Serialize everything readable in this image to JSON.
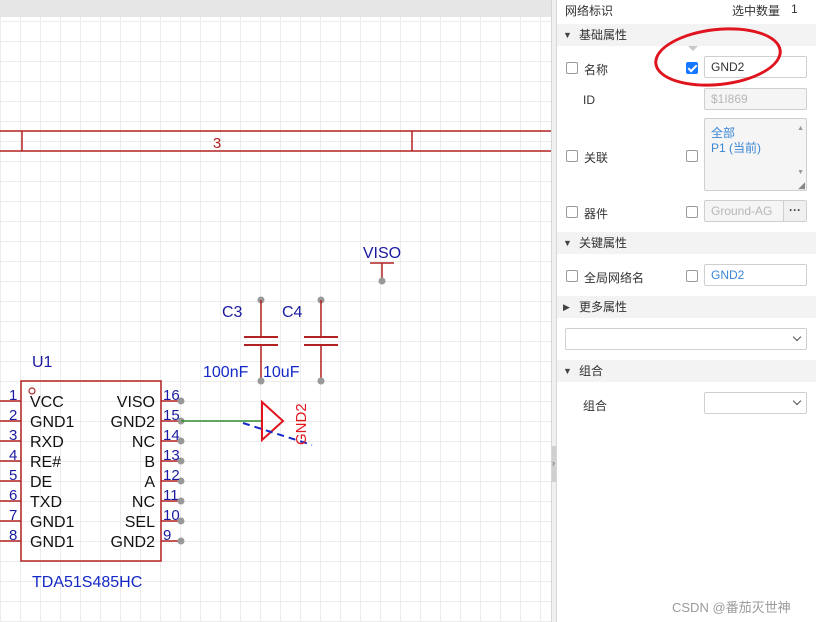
{
  "colors": {
    "wire": "#b22222",
    "net_wire": "#2e8b2e",
    "text_blue": "#1a1aa0",
    "net_label": "#1428c8",
    "accent": "#1677ff",
    "annotation": "#e0141e"
  },
  "schematic": {
    "bus_label": "3",
    "visio_label": "VISO",
    "c3_ref": "C3",
    "c4_ref": "C4",
    "c3_value": "100nF",
    "c4_value": "10uF",
    "u1_ref": "U1",
    "u1_part": "TDA51S485HC",
    "gnd_flag": "GND2",
    "pins_left": [
      {
        "num": "1",
        "name": "VCC"
      },
      {
        "num": "2",
        "name": "GND1"
      },
      {
        "num": "3",
        "name": "RXD"
      },
      {
        "num": "4",
        "name": "RE#"
      },
      {
        "num": "5",
        "name": "DE"
      },
      {
        "num": "6",
        "name": "TXD"
      },
      {
        "num": "7",
        "name": "GND1"
      },
      {
        "num": "8",
        "name": "GND1"
      }
    ],
    "pins_right": [
      {
        "num": "16",
        "name": "VISO"
      },
      {
        "num": "15",
        "name": "GND2"
      },
      {
        "num": "14",
        "name": "NC"
      },
      {
        "num": "13",
        "name": "B"
      },
      {
        "num": "12",
        "name": "A"
      },
      {
        "num": "11",
        "name": "NC"
      },
      {
        "num": "10",
        "name": "SEL"
      },
      {
        "num": "9",
        "name": "GND2"
      }
    ]
  },
  "panel": {
    "header_label": "网络标识",
    "selected_label": "选中数量",
    "selected_count": "1",
    "section_basic": "基础属性",
    "name_label": "名称",
    "name_value": "GND2",
    "id_label": "ID",
    "id_value": "$1I869",
    "assoc_label": "关联",
    "assoc_lines": [
      "全部",
      "P1 (当前)"
    ],
    "device_label": "器件",
    "device_value": "Ground-AG",
    "device_btn": "···",
    "section_key": "关键属性",
    "global_net_label": "全局网络名",
    "global_net_value": "GND2",
    "section_more": "更多属性",
    "more_select_value": "",
    "section_group": "组合",
    "group_label": "组合",
    "group_select_value": ""
  },
  "watermark": "CSDN @番茄灭世神"
}
